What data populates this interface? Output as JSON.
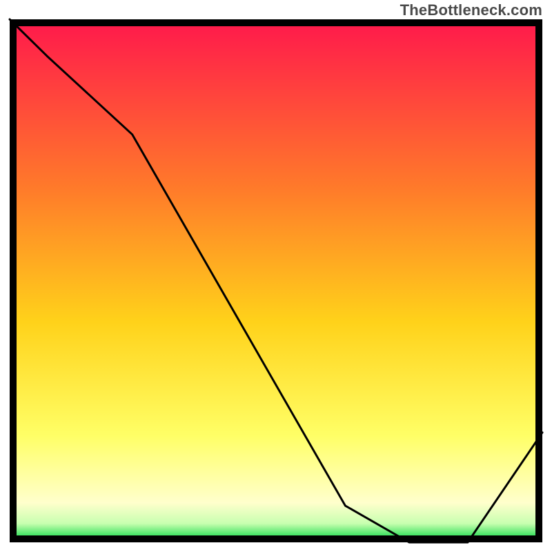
{
  "watermark": "TheBottleneck.com",
  "colors": {
    "border": "#000000",
    "curve": "#000000",
    "marker": "#ff1a33",
    "grad_top": "#ff1a4b",
    "grad_upper_mid": "#ff7a2a",
    "grad_mid": "#ffd21a",
    "grad_lower_mid": "#ffff66",
    "grad_pale": "#ffffcc",
    "grad_green": "#1adb4d"
  },
  "chart_data": {
    "type": "line",
    "title": "",
    "xlabel": "",
    "ylabel": "",
    "xlim": [
      0,
      100
    ],
    "ylim": [
      0,
      100
    ],
    "curve": {
      "x": [
        0,
        7,
        23,
        63,
        75,
        86,
        100
      ],
      "y": [
        100,
        93,
        78,
        7,
        0,
        0,
        21
      ]
    },
    "marker_segment": {
      "x0": 75,
      "x1": 86,
      "y": 0
    },
    "notes": "Approximate bottleneck chart. Curve descends from top-left, kinks around x≈23, reaches zero across x≈75–86 (red marker band at bottom), then rises toward x=100. Background is a vertical gradient from red at top through orange → yellow → pale yellow → thin green band near the bottom."
  }
}
